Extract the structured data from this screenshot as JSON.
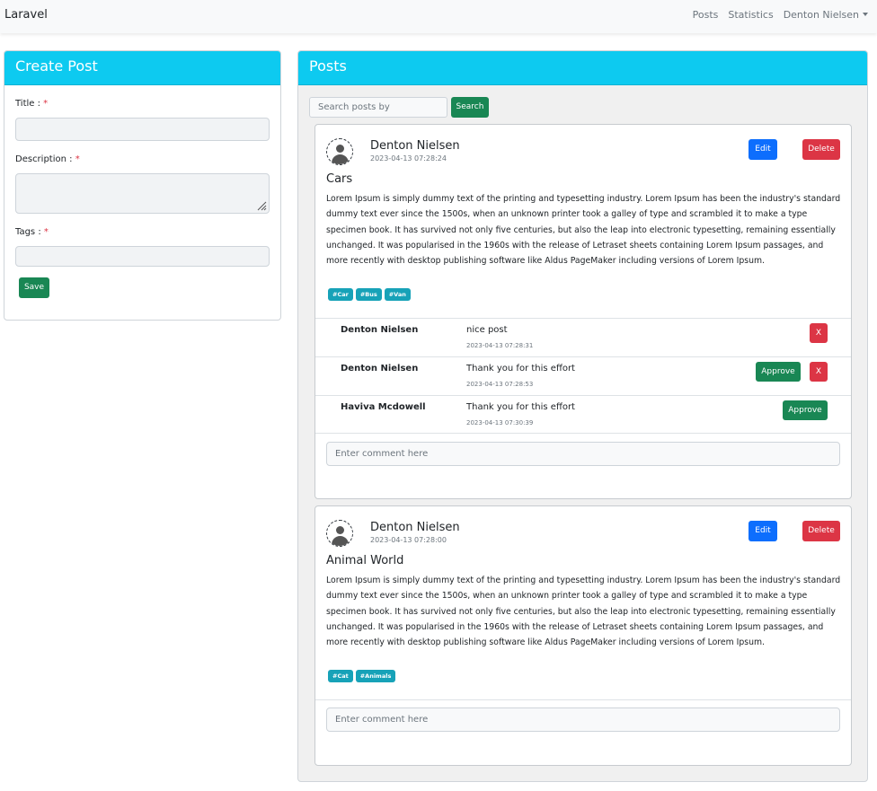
{
  "navbar": {
    "brand": "Laravel",
    "links": [
      "Posts",
      "Statistics"
    ],
    "user": "Denton Nielsen"
  },
  "create_post": {
    "header": "Create Post",
    "title_label": "Title :",
    "description_label": "Description :",
    "tags_label": "Tags :",
    "required_mark": "*",
    "save_label": "Save"
  },
  "posts_panel": {
    "header": "Posts",
    "search_placeholder": "Search posts by",
    "search_label": "Search",
    "edit_label": "Edit",
    "delete_label": "Delete",
    "approve_label": "Approve",
    "remove_label": "X",
    "comment_placeholder": "Enter comment here"
  },
  "posts": [
    {
      "author": "Denton Nielsen",
      "date": "2023-04-13 07:28:24",
      "title": "Cars",
      "description": "Lorem Ipsum is simply dummy text of the printing and typesetting industry. Lorem Ipsum has been the industry's standard dummy text ever since the 1500s, when an unknown printer took a galley of type and scrambled it to make a type specimen book. It has survived not only five centuries, but also the leap into electronic typesetting, remaining essentially unchanged. It was popularised in the 1960s with the release of Letraset sheets containing Lorem Ipsum passages, and more recently with desktop publishing software like Aldus PageMaker including versions of Lorem Ipsum.",
      "tags": [
        "#Car",
        "#Bus",
        "#Van"
      ],
      "comments": [
        {
          "author": "Denton Nielsen",
          "text": "nice post",
          "date": "2023-04-13 07:28:31"
        },
        {
          "author": "Denton Nielsen",
          "text": "Thank you for this effort",
          "date": "2023-04-13 07:28:53"
        },
        {
          "author": "Haviva Mcdowell",
          "text": "Thank you for this effort",
          "date": "2023-04-13 07:30:39"
        }
      ]
    },
    {
      "author": "Denton Nielsen",
      "date": "2023-04-13 07:28:00",
      "title": "Animal World",
      "description": "Lorem Ipsum is simply dummy text of the printing and typesetting industry. Lorem Ipsum has been the industry's standard dummy text ever since the 1500s, when an unknown printer took a galley of type and scrambled it to make a type specimen book. It has survived not only five centuries, but also the leap into electronic typesetting, remaining essentially unchanged. It was popularised in the 1960s with the release of Letraset sheets containing Lorem Ipsum passages, and more recently with desktop publishing software like Aldus PageMaker including versions of Lorem Ipsum.",
      "tags": [
        "#Cat",
        "#Animals"
      ],
      "comments": []
    }
  ],
  "colors": {
    "header_accent": "#0dcaf0",
    "success": "#198754",
    "primary": "#0d6efd",
    "danger": "#dc3545",
    "tag": "#17a2b8"
  },
  "icons": [
    "user-avatar-icon",
    "dropdown-caret-icon",
    "textarea-resize-icon"
  ]
}
